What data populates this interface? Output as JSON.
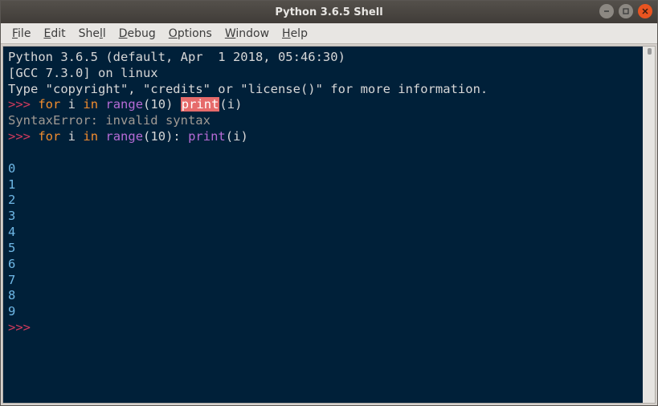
{
  "titlebar": {
    "title": "Python 3.6.5 Shell"
  },
  "menubar": {
    "items": [
      {
        "underline": "F",
        "rest": "ile"
      },
      {
        "underline": "E",
        "rest": "dit"
      },
      {
        "underline": "",
        "rest1": "She",
        "u2": "l",
        "rest2": "l"
      },
      {
        "underline": "D",
        "rest": "ebug"
      },
      {
        "underline": "O",
        "rest": "ptions"
      },
      {
        "underline": "W",
        "rest": "indow"
      },
      {
        "underline": "H",
        "rest": "elp"
      }
    ]
  },
  "console": {
    "banner1": "Python 3.6.5 (default, Apr  1 2018, 05:46:30) ",
    "banner2": "[GCC 7.3.0] on linux",
    "banner3": "Type \"copyright\", \"credits\" or \"license()\" for more information.",
    "prompt": ">>> ",
    "code1": {
      "kw_for": "for",
      "sp": " ",
      "var_i": "i",
      "kw_in": "in",
      "func_range": "range",
      "open": "(",
      "num_10": "10",
      "close": ")",
      "func_print_hl": "print",
      "open2": "(",
      "var_i2": "i",
      "close2": ")"
    },
    "error": "SyntaxError: invalid syntax",
    "code2": {
      "kw_for": "for",
      "sp": " ",
      "var_i": "i",
      "kw_in": "in",
      "func_range": "range",
      "open": "(",
      "num_10": "10",
      "close": ")",
      "colon": ":",
      "func_print": "print",
      "open2": "(",
      "var_i2": "i",
      "close2": ")"
    },
    "blank": "",
    "outputs": [
      "0",
      "1",
      "2",
      "3",
      "4",
      "5",
      "6",
      "7",
      "8",
      "9"
    ],
    "prompt_empty": ">>> "
  }
}
